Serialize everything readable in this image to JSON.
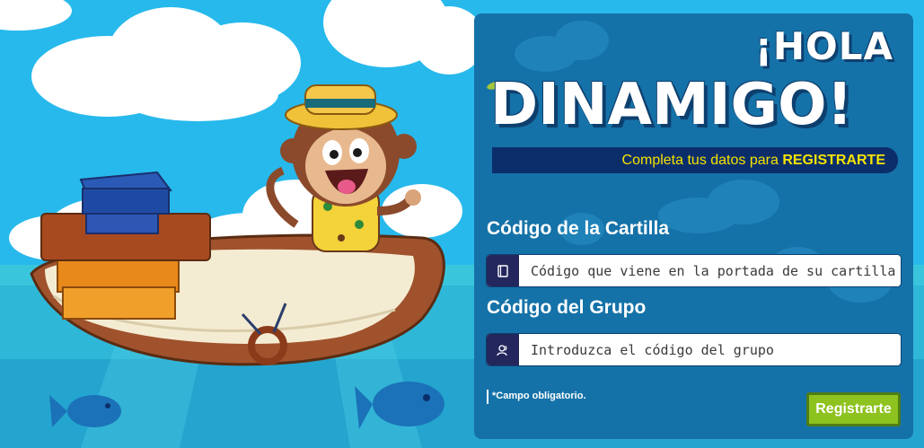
{
  "header": {
    "greeting": "¡HOLA",
    "brand": "DINAMIGO!",
    "subtitle_prefix": "Completa tus datos para",
    "subtitle_strong": "REGISTRARTE"
  },
  "form": {
    "booklet_code": {
      "label": "Código de la Cartilla",
      "value": "",
      "placeholder": "Código que viene en la portada de su cartilla",
      "icon": "book-icon"
    },
    "group_code": {
      "label": "Código del Grupo",
      "value": "",
      "placeholder": "Introduzca el código del grupo",
      "icon": "users-icon"
    },
    "required_note": "*Campo obligatorio.",
    "submit_label": "Registrarte"
  },
  "illustration": {
    "subject": "monkey-in-boat",
    "colors": {
      "sky": "#27b9ec",
      "sea": "#39c6dd",
      "panel": "#1572a8",
      "accent_green": "#8dc21f",
      "banner": "#0b2e6b",
      "banner_text": "#f6e300"
    }
  }
}
